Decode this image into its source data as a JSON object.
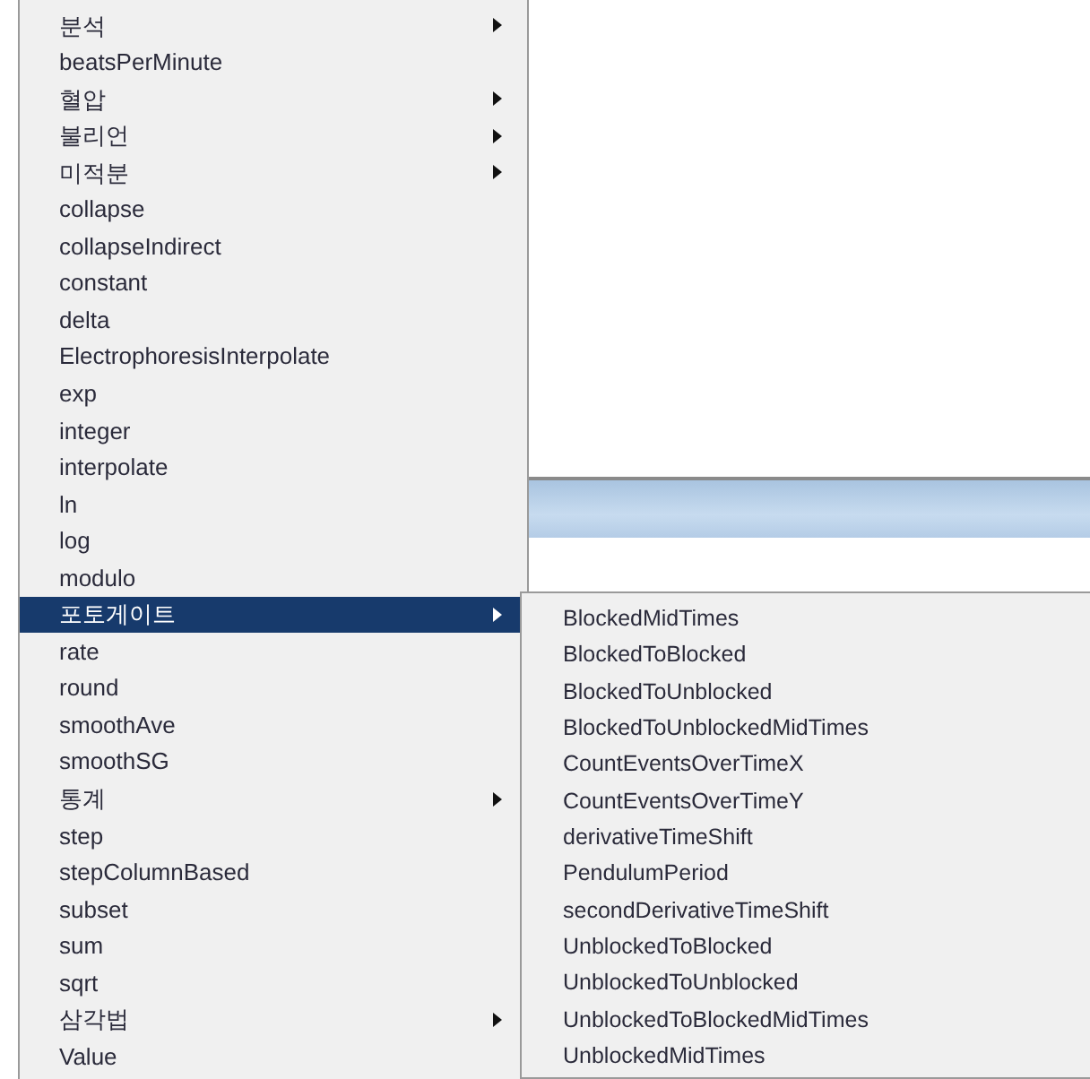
{
  "menu": {
    "items": [
      {
        "label": "분석",
        "submenu": true,
        "selected": false
      },
      {
        "label": "beatsPerMinute",
        "submenu": false,
        "selected": false
      },
      {
        "label": "혈압",
        "submenu": true,
        "selected": false
      },
      {
        "label": "불리언",
        "submenu": true,
        "selected": false
      },
      {
        "label": "미적분",
        "submenu": true,
        "selected": false
      },
      {
        "label": "collapse",
        "submenu": false,
        "selected": false
      },
      {
        "label": "collapseIndirect",
        "submenu": false,
        "selected": false
      },
      {
        "label": "constant",
        "submenu": false,
        "selected": false
      },
      {
        "label": "delta",
        "submenu": false,
        "selected": false
      },
      {
        "label": "ElectrophoresisInterpolate",
        "submenu": false,
        "selected": false
      },
      {
        "label": "exp",
        "submenu": false,
        "selected": false
      },
      {
        "label": "integer",
        "submenu": false,
        "selected": false
      },
      {
        "label": "interpolate",
        "submenu": false,
        "selected": false
      },
      {
        "label": "ln",
        "submenu": false,
        "selected": false
      },
      {
        "label": "log",
        "submenu": false,
        "selected": false
      },
      {
        "label": "modulo",
        "submenu": false,
        "selected": false
      },
      {
        "label": "포토게이트",
        "submenu": true,
        "selected": true
      },
      {
        "label": "rate",
        "submenu": false,
        "selected": false
      },
      {
        "label": "round",
        "submenu": false,
        "selected": false
      },
      {
        "label": "smoothAve",
        "submenu": false,
        "selected": false
      },
      {
        "label": "smoothSG",
        "submenu": false,
        "selected": false
      },
      {
        "label": "통계",
        "submenu": true,
        "selected": false
      },
      {
        "label": "step",
        "submenu": false,
        "selected": false
      },
      {
        "label": "stepColumnBased",
        "submenu": false,
        "selected": false
      },
      {
        "label": "subset",
        "submenu": false,
        "selected": false
      },
      {
        "label": "sum",
        "submenu": false,
        "selected": false
      },
      {
        "label": "sqrt",
        "submenu": false,
        "selected": false
      },
      {
        "label": "삼각법",
        "submenu": true,
        "selected": false
      },
      {
        "label": "Value",
        "submenu": false,
        "selected": false
      }
    ]
  },
  "submenu": {
    "items": [
      "BlockedMidTimes",
      "BlockedToBlocked",
      "BlockedToUnblocked",
      "BlockedToUnblockedMidTimes",
      "CountEventsOverTimeX",
      "CountEventsOverTimeY",
      "derivativeTimeShift",
      "PendulumPeriod",
      "secondDerivativeTimeShift",
      "UnblockedToBlocked",
      "UnblockedToUnblocked",
      "UnblockedToBlockedMidTimes",
      "UnblockedMidTimes"
    ]
  }
}
